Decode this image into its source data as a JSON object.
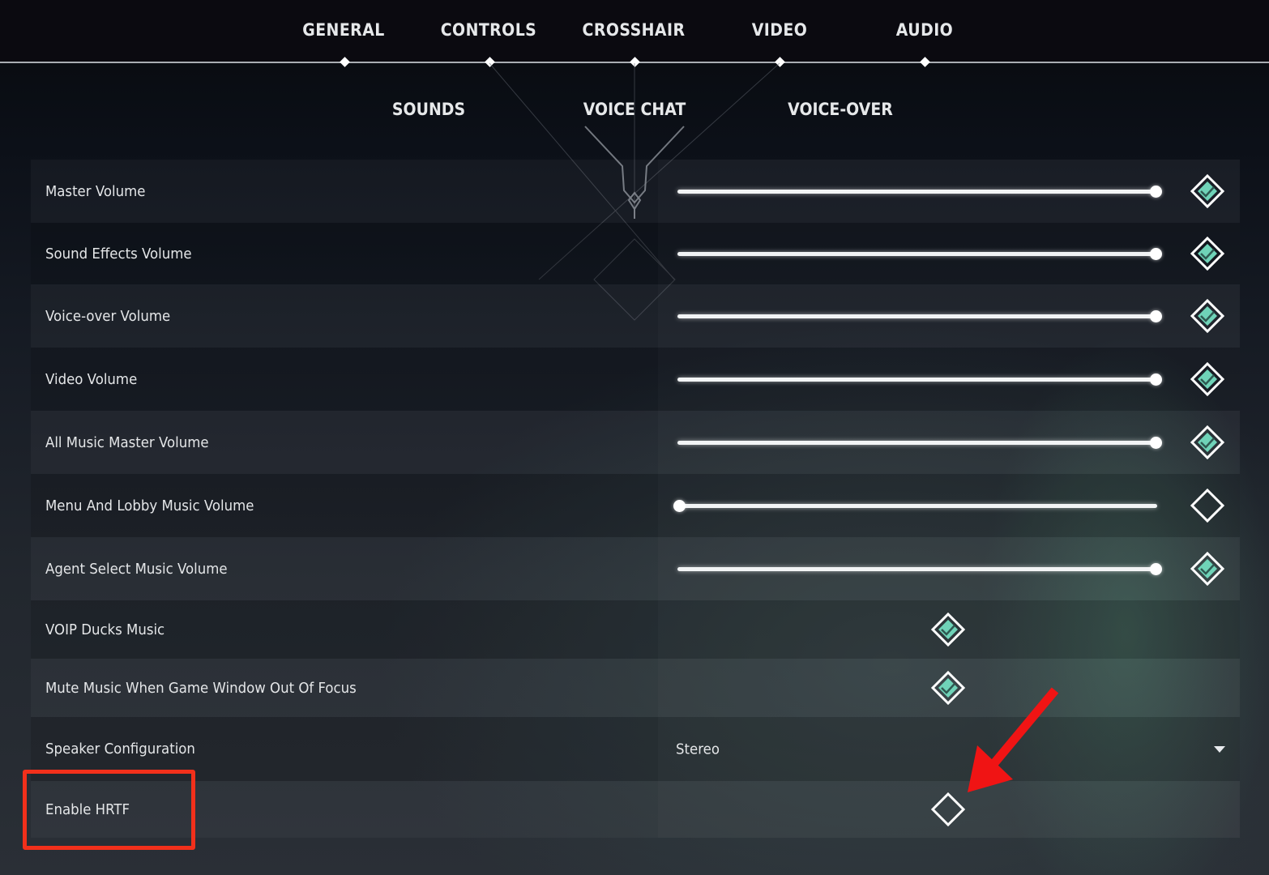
{
  "main_tabs": [
    {
      "label": "GENERAL"
    },
    {
      "label": "CONTROLS"
    },
    {
      "label": "CROSSHAIR"
    },
    {
      "label": "VIDEO"
    },
    {
      "label": "AUDIO",
      "active": true
    }
  ],
  "sub_tabs": [
    {
      "label": "SOUNDS",
      "active": true
    },
    {
      "label": "VOICE CHAT"
    },
    {
      "label": "VOICE-OVER"
    }
  ],
  "colors": {
    "accent_teal": "#6fd3b8",
    "highlight_red": "#f2301b",
    "text": "#e4e6e8"
  },
  "settings": [
    {
      "label": "Master Volume",
      "type": "slider",
      "value_percent": 100,
      "enabled": true
    },
    {
      "label": "Sound Effects Volume",
      "type": "slider",
      "value_percent": 100,
      "enabled": true
    },
    {
      "label": "Voice-over Volume",
      "type": "slider",
      "value_percent": 100,
      "enabled": true
    },
    {
      "label": "Video Volume",
      "type": "slider",
      "value_percent": 100,
      "enabled": true
    },
    {
      "label": "All Music Master Volume",
      "type": "slider",
      "value_percent": 100,
      "enabled": true
    },
    {
      "label": "Menu And Lobby Music Volume",
      "type": "slider",
      "value_percent": 0,
      "enabled": false
    },
    {
      "label": "Agent Select Music Volume",
      "type": "slider",
      "value_percent": 100,
      "enabled": true
    },
    {
      "label": "VOIP Ducks Music",
      "type": "checkbox",
      "checked": true
    },
    {
      "label": "Mute Music When Game Window Out Of Focus",
      "type": "checkbox",
      "checked": true
    },
    {
      "label": "Speaker Configuration",
      "type": "dropdown",
      "value": "Stereo"
    },
    {
      "label": "Enable HRTF",
      "type": "checkbox",
      "checked": false
    }
  ],
  "annotations": {
    "highlighted_setting": "Enable HRTF",
    "arrow_target": "Enable HRTF checkbox"
  }
}
